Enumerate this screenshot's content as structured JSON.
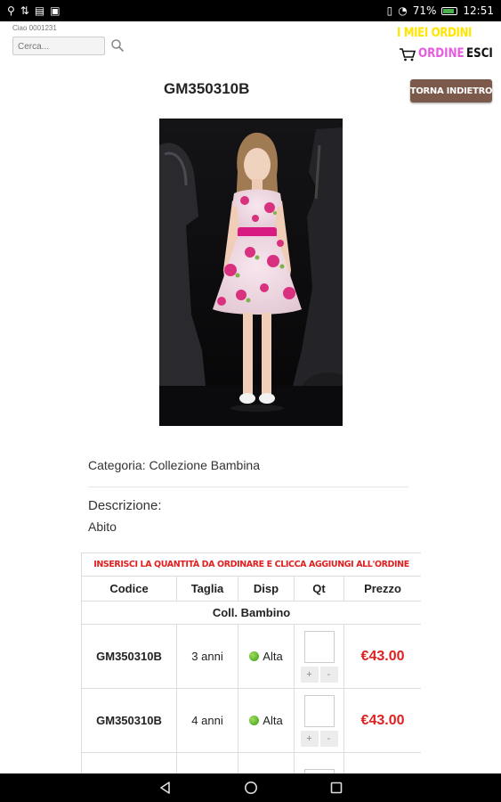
{
  "status_bar": {
    "battery": "71%",
    "time": "12:51"
  },
  "header": {
    "greeting": "Ciao 0001231",
    "search_placeholder": "Cerca...",
    "my_orders": "I MIEI ORDINI",
    "order_link": "ORDINE",
    "exit_link": "ESCI"
  },
  "product": {
    "code": "GM350310B",
    "back_button": "TORNA INDIETRO",
    "category_label": "Categoria:",
    "category_value": "Collezione Bambina",
    "description_label": "Descrizione:",
    "description_value": "Abito"
  },
  "order_table": {
    "instruction": "INSERISCI LA QUANTITÀ DA ORDINARE E CLICCA AGGIUNGI ALL'ORDINE",
    "headers": [
      "Codice",
      "Taglia",
      "Disp",
      "Qt",
      "Prezzo"
    ],
    "collection": "Coll. Bambino",
    "rows": [
      {
        "code": "GM350310B",
        "size": "3 anni",
        "availability": "Alta",
        "qty": "",
        "price": "€43.00"
      },
      {
        "code": "GM350310B",
        "size": "4 anni",
        "availability": "Alta",
        "qty": "",
        "price": "€43.00"
      },
      {
        "code": "",
        "size": "",
        "availability": "",
        "qty": "",
        "price": ""
      }
    ],
    "stepper_plus": "+",
    "stepper_minus": "-"
  },
  "colors": {
    "my_orders": "#ffe600",
    "order_link": "#e55ce0",
    "back_button": "#7b5a4b",
    "price": "#e02020",
    "availability_high": "#3f9a16"
  }
}
